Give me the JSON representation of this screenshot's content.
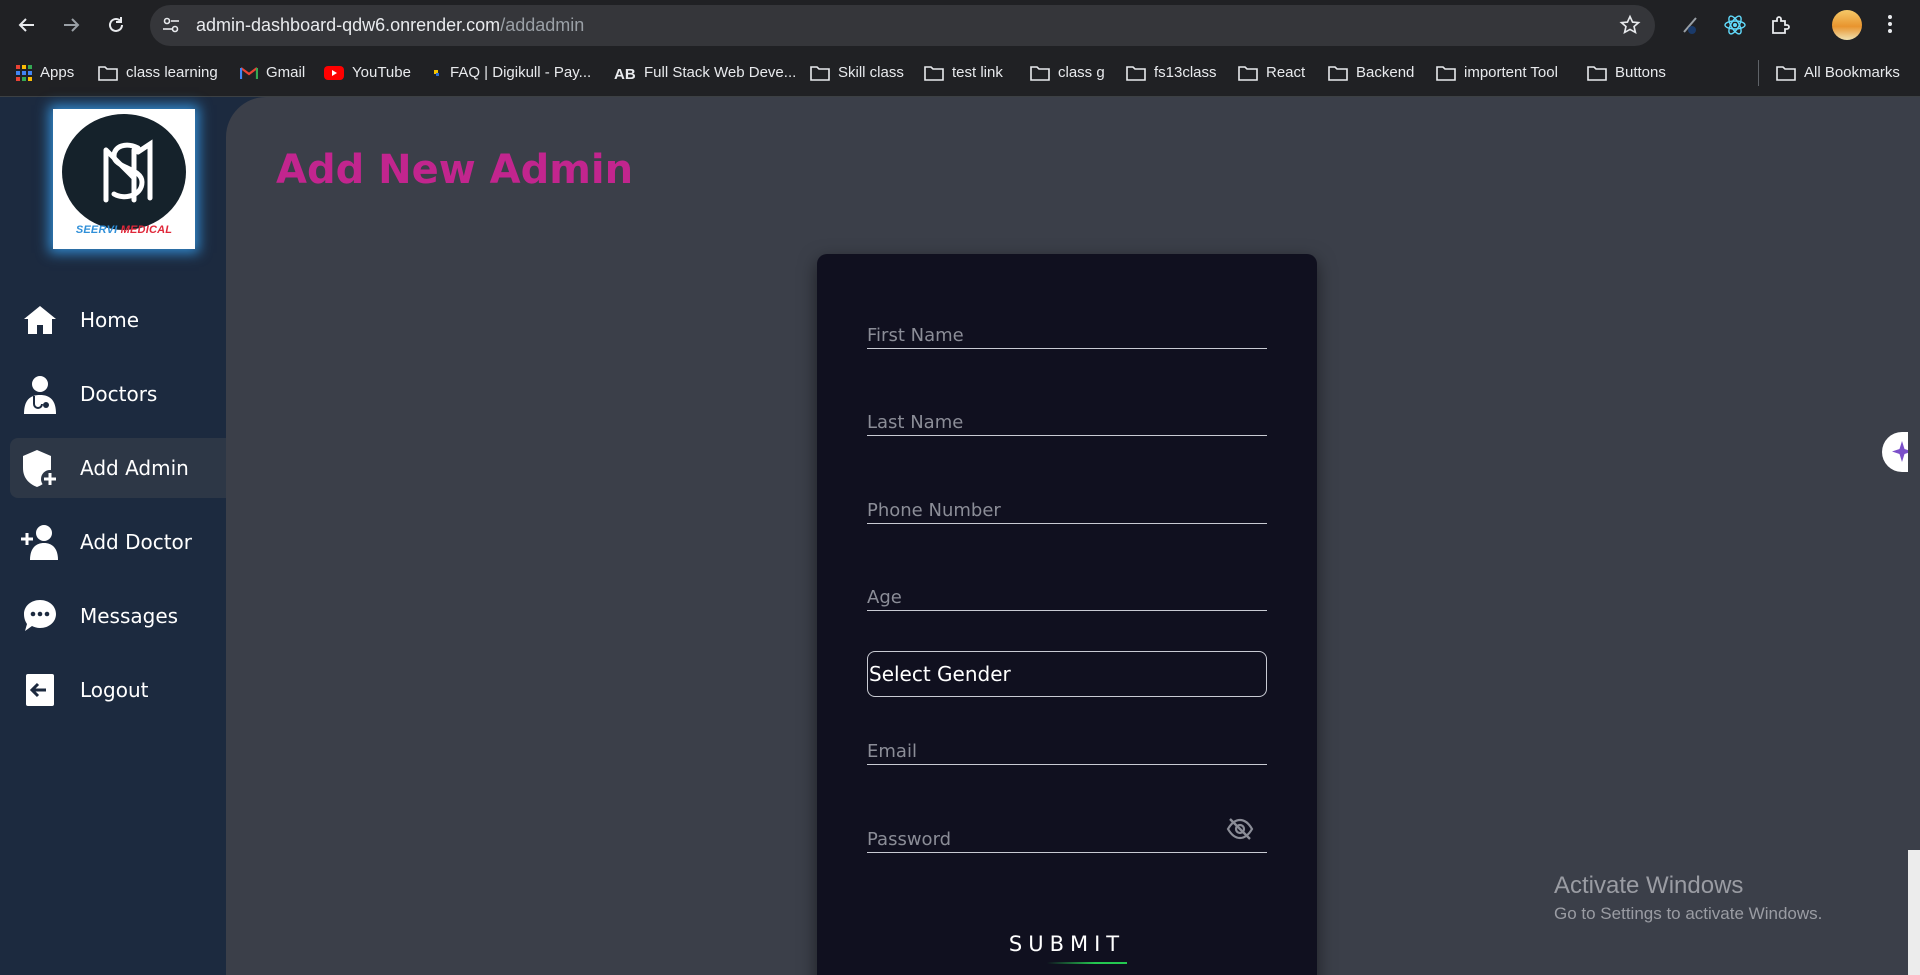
{
  "browser": {
    "url_host": "admin-dashboard-qdw6.onrender.com",
    "url_path": "/addadmin",
    "bookmarks": [
      {
        "label": "Apps",
        "icon": "apps-grid-icon"
      },
      {
        "label": "class learning",
        "icon": "folder-icon"
      },
      {
        "label": "Gmail",
        "icon": "gmail-icon"
      },
      {
        "label": "YouTube",
        "icon": "youtube-icon"
      },
      {
        "label": "FAQ | Digikull - Pay...",
        "icon": "digikull-icon"
      },
      {
        "label": "Full Stack Web Deve...",
        "icon": "ab-icon"
      },
      {
        "label": "Skill class",
        "icon": "folder-icon"
      },
      {
        "label": "test link",
        "icon": "folder-icon"
      },
      {
        "label": "class g",
        "icon": "folder-icon"
      },
      {
        "label": "fs13class",
        "icon": "folder-icon"
      },
      {
        "label": "React",
        "icon": "folder-icon"
      },
      {
        "label": "Backend",
        "icon": "folder-icon"
      },
      {
        "label": "importent Tool",
        "icon": "folder-icon"
      },
      {
        "label": "Buttons",
        "icon": "folder-icon"
      }
    ],
    "all_bookmarks": "All Bookmarks"
  },
  "sidebar": {
    "logo_text_blue": "SEERVI",
    "logo_text_red": "MEDICAL",
    "items": [
      {
        "label": "Home",
        "icon": "home-icon",
        "active": false
      },
      {
        "label": "Doctors",
        "icon": "doctor-icon",
        "active": false
      },
      {
        "label": "Add Admin",
        "icon": "shield-plus-icon",
        "active": true
      },
      {
        "label": "Add Doctor",
        "icon": "user-plus-icon",
        "active": false
      },
      {
        "label": "Messages",
        "icon": "chat-icon",
        "active": false
      },
      {
        "label": "Logout",
        "icon": "logout-icon",
        "active": false
      }
    ]
  },
  "main": {
    "title": "Add New Admin",
    "form": {
      "first_name_placeholder": "First Name",
      "last_name_placeholder": "Last Name",
      "phone_placeholder": "Phone Number",
      "age_placeholder": "Age",
      "gender_selected": "Select Gender",
      "email_placeholder": "Email",
      "password_placeholder": "Password",
      "submit_label": "SUBMIT"
    }
  },
  "watermark": {
    "line1": "Activate Windows",
    "line2": "Go to Settings to activate Windows."
  },
  "colors": {
    "title": "#c2258e",
    "sidebar_bg": "#1c2a3f",
    "main_bg": "#3b3f49",
    "card_bg": "#10101f",
    "submit_underline": "#24c850"
  }
}
